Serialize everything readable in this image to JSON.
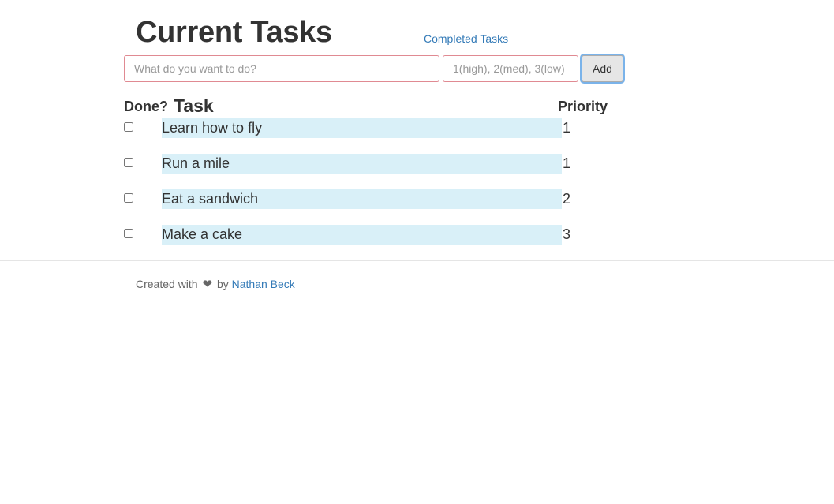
{
  "header": {
    "title": "Current Tasks",
    "completed_link": "Completed Tasks"
  },
  "form": {
    "task_placeholder": "What do you want to do?",
    "priority_placeholder": "1(high), 2(med), 3(low)",
    "add_label": "Add"
  },
  "table": {
    "headers": {
      "done": "Done?",
      "task": "Task",
      "priority": "Priority"
    },
    "rows": [
      {
        "task": "Learn how to fly",
        "priority": "1",
        "done": false
      },
      {
        "task": "Run a mile",
        "priority": "1",
        "done": false
      },
      {
        "task": "Eat a sandwich",
        "priority": "2",
        "done": false
      },
      {
        "task": "Make a cake",
        "priority": "3",
        "done": false
      }
    ]
  },
  "footer": {
    "prefix": "Created with",
    "icon": "heart-icon",
    "by": "by",
    "author": "Nathan Beck"
  },
  "colors": {
    "link": "#337ab7",
    "row_highlight": "#d9f0f8",
    "input_border": "#e08a92",
    "button_focus": "#7ab3ea"
  }
}
